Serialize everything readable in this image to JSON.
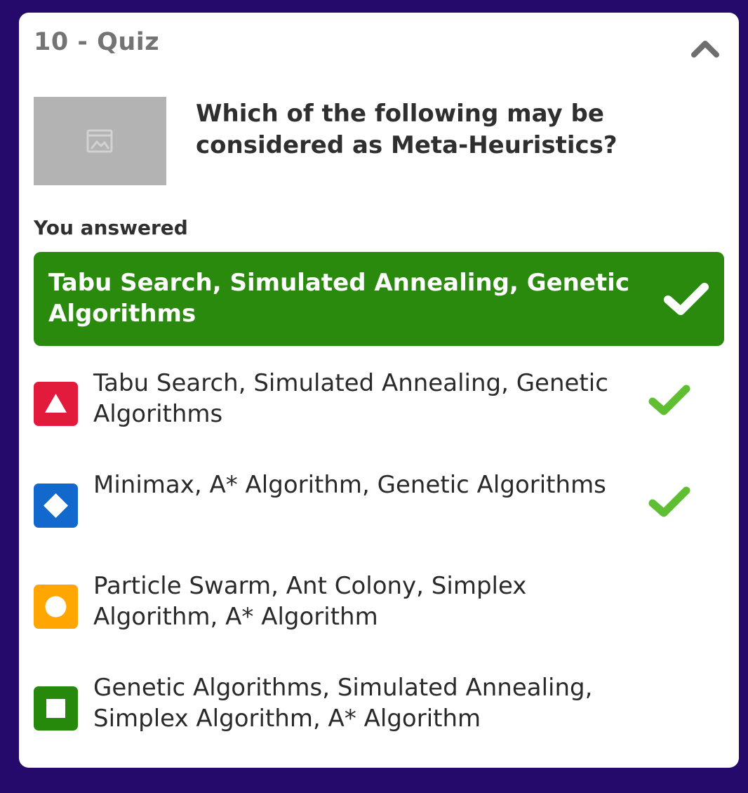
{
  "header": {
    "title": "10 - Quiz"
  },
  "question": {
    "text": "Which of the following may be considered as Meta-Heuristics?",
    "image_icon": "image-placeholder-icon"
  },
  "result": {
    "label": "You answered",
    "answer": "Tabu Search, Simulated Annealing, Genetic Algorithms",
    "status_icon": "check-icon"
  },
  "options": [
    {
      "text": "Tabu Search, Simulated Annealing, Genetic Algorithms",
      "shape": "triangle",
      "color": "#e21b3c",
      "correct": true
    },
    {
      "text": "Minimax, A* Algorithm, Genetic Algorithms",
      "shape": "diamond",
      "color": "#1368ce",
      "correct": true
    },
    {
      "text": "Particle Swarm, Ant Colony, Simplex Algorithm, A* Algorithm",
      "shape": "circle",
      "color": "#ffa602",
      "correct": false
    },
    {
      "text": "Genetic Algorithms, Simulated Annealing, Simplex Algorithm, A* Algorithm",
      "shape": "square",
      "color": "#26890c",
      "correct": false
    }
  ],
  "colors": {
    "background": "#250a6b",
    "correct_banner": "#2a8a0e",
    "check_green": "#5fbe32"
  }
}
